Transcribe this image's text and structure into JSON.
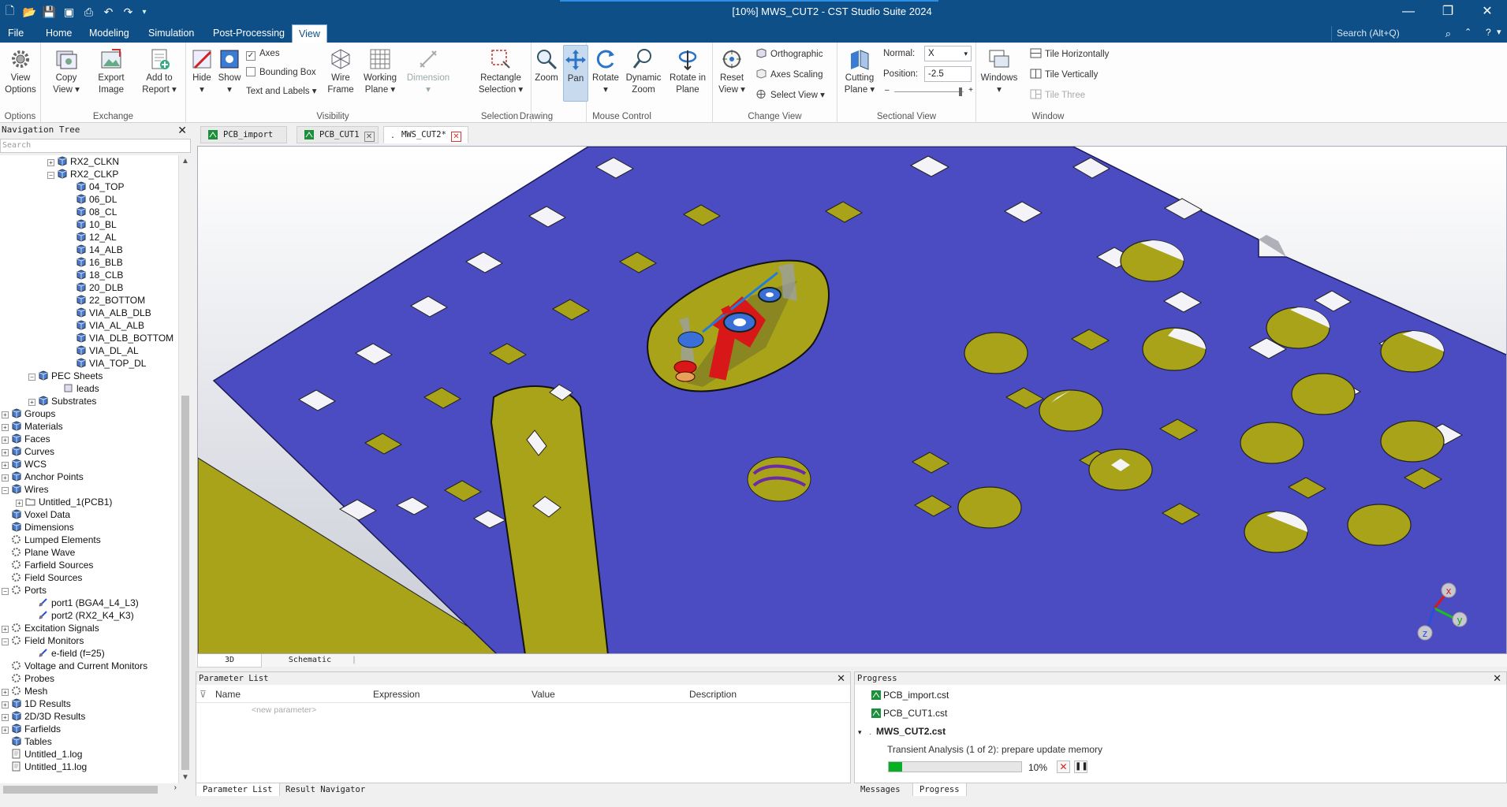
{
  "window": {
    "title": "[10%] MWS_CUT2 - CST Studio Suite 2024"
  },
  "menu": {
    "tabs": [
      "File",
      "Home",
      "Modeling",
      "Simulation",
      "Post-Processing",
      "View"
    ],
    "active": "View",
    "search_placeholder": "Search (Alt+Q)"
  },
  "ribbon": {
    "groups": {
      "options": "Options",
      "exchange": "Exchange",
      "visibility": "Visibility",
      "drawing": "Drawing",
      "selection": "Selection",
      "mouse_control": "Mouse Control",
      "change_view": "Change View",
      "sectional_view": "Sectional View",
      "window": "Window"
    },
    "view_options": "View Options",
    "copy_view": "Copy View",
    "export_image": "Export Image",
    "add_to_report": "Add to Report",
    "hide": "Hide",
    "show": "Show",
    "axes": "Axes",
    "bounding_box": "Bounding Box",
    "text_and_labels": "Text and Labels",
    "wire_frame": "Wire Frame",
    "working_plane": "Working Plane",
    "dimension": "Dimension",
    "rectangle_selection": "Rectangle Selection",
    "zoom": "Zoom",
    "pan": "Pan",
    "rotate": "Rotate",
    "dynamic_zoom": "Dynamic Zoom",
    "rotate_in_plane": "Rotate in Plane",
    "reset_view": "Reset View",
    "orthographic": "Orthographic",
    "axes_scaling": "Axes Scaling",
    "select_view": "Select View",
    "cutting_plane": "Cutting Plane",
    "normal_label": "Normal:",
    "normal_value": "X",
    "position_label": "Position:",
    "position_value": "-2.5",
    "windows": "Windows",
    "tile_horizontally": "Tile Horizontally",
    "tile_vertically": "Tile Vertically",
    "tile_three": "Tile Three"
  },
  "nav": {
    "title": "Navigation Tree",
    "search_placeholder": "Search",
    "items": [
      "RX2_CLKN",
      "RX2_CLKP",
      "04_TOP",
      "06_DL",
      "08_CL",
      "10_BL",
      "12_AL",
      "14_ALB",
      "16_BLB",
      "18_CLB",
      "20_DLB",
      "22_BOTTOM",
      "VIA_ALB_DLB",
      "VIA_AL_ALB",
      "VIA_DLB_BOTTOM",
      "VIA_DL_AL",
      "VIA_TOP_DL",
      "PEC Sheets",
      "leads",
      "Substrates",
      "Groups",
      "Materials",
      "Faces",
      "Curves",
      "WCS",
      "Anchor Points",
      "Wires",
      "Untitled_1(PCB1)",
      "Voxel Data",
      "Dimensions",
      "Lumped Elements",
      "Plane Wave",
      "Farfield Sources",
      "Field Sources",
      "Ports",
      "port1 (BGA4_L4_L3)",
      "port2 (RX2_K4_K3)",
      "Excitation Signals",
      "Field Monitors",
      "e-field (f=25)",
      "Voltage and Current Monitors",
      "Probes",
      "Mesh",
      "1D Results",
      "2D/3D Results",
      "Farfields",
      "Tables",
      "Untitled_1.log",
      "Untitled_11.log"
    ]
  },
  "doc_tabs": [
    "PCB_import",
    "PCB_CUT1",
    "MWS_CUT2*"
  ],
  "view_tabs": [
    "3D",
    "Schematic"
  ],
  "axes_labels": {
    "x": "x",
    "y": "y",
    "z": "z"
  },
  "param_list": {
    "title": "Parameter List",
    "columns": [
      "Name",
      "Expression",
      "Value",
      "Description"
    ],
    "new_param": "<new parameter>"
  },
  "bottom_left_tabs": [
    "Parameter List",
    "Result Navigator"
  ],
  "progress": {
    "title": "Progress",
    "files": [
      "PCB_import.cst",
      "PCB_CUT1.cst"
    ],
    "current": "MWS_CUT2.cst",
    "task": "Transient Analysis (1 of 2): prepare update memory",
    "percent_text": "10%",
    "percent": 0.1
  },
  "bottom_right_tabs": [
    "Messages",
    "Progress"
  ],
  "colors": {
    "accent": "#0e4f87",
    "board": "#4b4bc2",
    "copper": "#a8a318",
    "port": "#d81818",
    "progress": "#06b025"
  }
}
